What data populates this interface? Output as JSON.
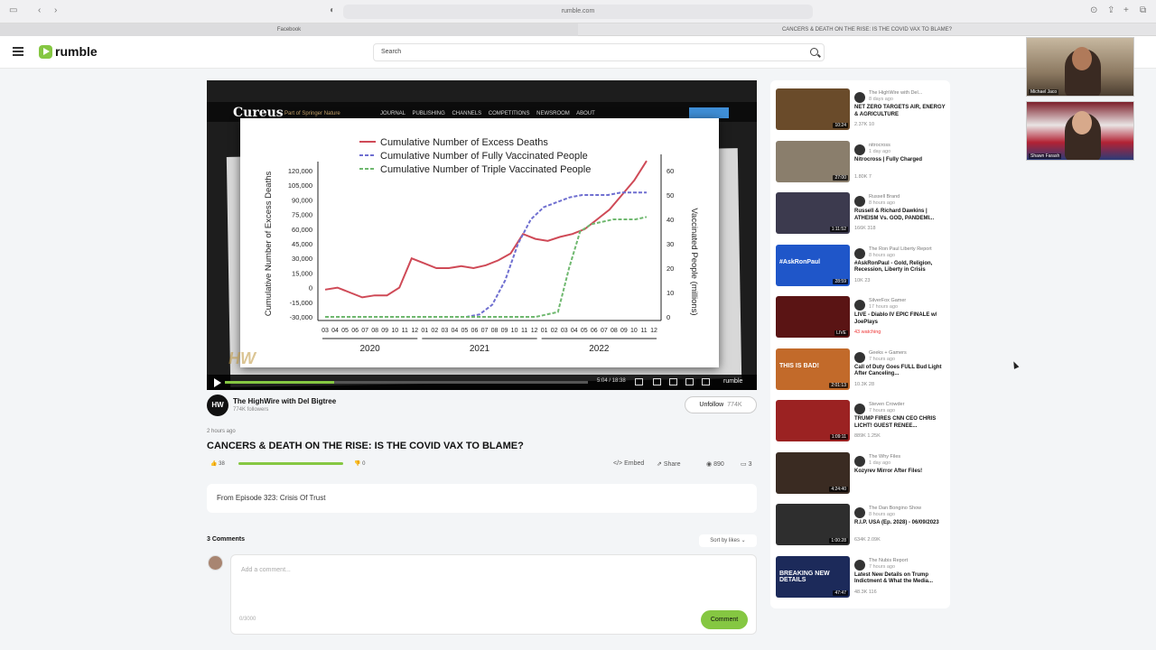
{
  "browser": {
    "url": "rumble.com",
    "tabs": [
      "Facebook",
      "CANCERS & DEATH ON THE RISE: IS THE COVID VAX TO BLAME?"
    ]
  },
  "header": {
    "logo": "rumble",
    "search_placeholder": "Search"
  },
  "webcams": [
    {
      "name": "Michael Jaco"
    },
    {
      "name": "Shawn Farash"
    }
  ],
  "player": {
    "site_logo": "Cureus",
    "site_sub": "Part of Springer Nature",
    "site_nav": "JOURNAL PUBLISHING CHANNELS COMPETITIONS NEWSROOM ABOUT",
    "time": "5:04 / 18:38",
    "brand": "rumble",
    "progress_fraction": 0.3
  },
  "chart_data": {
    "type": "line",
    "title": "",
    "ylabel": "Cumulative Number of Excess Deaths",
    "y2label": "Vaccinated People (millions)",
    "yticks": [
      "120,000",
      "105,000",
      "90,000",
      "75,000",
      "60,000",
      "45,000",
      "30,000",
      "15,000",
      "0",
      "-15,000",
      "-30,000"
    ],
    "ylim": [
      -30000,
      120000
    ],
    "y2ticks": [
      "60",
      "50",
      "40",
      "30",
      "20",
      "10",
      "0"
    ],
    "y2lim": [
      0,
      60
    ],
    "xticks": [
      "03",
      "04",
      "05",
      "06",
      "07",
      "08",
      "09",
      "10",
      "11",
      "12",
      "01",
      "02",
      "03",
      "04",
      "05",
      "06",
      "07",
      "08",
      "09",
      "10",
      "11",
      "12",
      "01",
      "02",
      "03",
      "04",
      "05",
      "06",
      "07",
      "08",
      "09",
      "10",
      "11",
      "12"
    ],
    "years": [
      "2020",
      "2021",
      "2022"
    ],
    "legend_position": "top",
    "series": [
      {
        "name": "Cumulative Number of Excess Deaths",
        "color": "#cf4a57",
        "axis": "left",
        "values": [
          -2000,
          0,
          -5000,
          -10000,
          -8000,
          -8000,
          0,
          30000,
          25000,
          20000,
          20000,
          22000,
          20000,
          23000,
          28000,
          35000,
          55000,
          50000,
          48000,
          52000,
          55000,
          60000,
          70000,
          80000,
          95000,
          110000,
          130000
        ]
      },
      {
        "name": "Cumulative Number of Fully Vaccinated People",
        "color": "#6f6fd0",
        "axis": "right",
        "values": [
          0,
          0,
          0,
          0,
          0,
          0,
          0,
          0,
          0,
          0,
          0,
          0,
          1,
          5,
          15,
          30,
          40,
          45,
          47,
          49,
          50,
          50,
          50,
          51,
          51,
          51
        ]
      },
      {
        "name": "Cumulative Number of Triple Vaccinated People",
        "color": "#6fb86f",
        "axis": "right",
        "values": [
          0,
          0,
          0,
          0,
          0,
          0,
          0,
          0,
          0,
          0,
          0,
          0,
          0,
          0,
          0,
          0,
          0,
          0,
          0,
          0,
          1,
          2,
          20,
          35,
          38,
          39,
          40,
          40,
          40,
          41
        ]
      }
    ]
  },
  "channel": {
    "avatar": "HW",
    "name": "The HighWire with Del Bigtree",
    "followers": "774K followers",
    "unfollow_label": "Unfollow",
    "unfollow_count": "774K"
  },
  "video": {
    "posted": "2 hours ago",
    "title": "CANCERS & DEATH ON THE RISE: IS THE COVID VAX TO BLAME?",
    "likes": "38",
    "dislikes": "0",
    "embed": "Embed",
    "share": "Share",
    "views": "890",
    "comment_count": "3",
    "description": "From Episode 323: Crisis Of Trust"
  },
  "comments": {
    "header": "3 Comments",
    "sort": "Sort by likes",
    "placeholder": "Add a comment...",
    "counter": "0/3000",
    "button": "Comment"
  },
  "sidebar": [
    {
      "channel": "The HighWire with Del...",
      "ago": "8 days ago",
      "title": "NET ZERO TARGETS AIR, ENERGY & AGRICULTURE",
      "stats": "2.37K  10",
      "duration": "10:24",
      "color": "#6a4b2a"
    },
    {
      "channel": "nitrocross",
      "ago": "1 day ago",
      "title": "Nitrocross | Fully Charged",
      "stats": "1.80K  7",
      "duration": "27:00",
      "color": "#8a7e6c"
    },
    {
      "channel": "Russell Brand",
      "ago": "8 hours ago",
      "title": "Russell & Richard Dawkins | ATHEISM Vs. GOD, PANDEMI...",
      "stats": "166K  318",
      "duration": "1:11:52",
      "color": "#3c3a4e"
    },
    {
      "channel": "The Ron Paul Liberty Report",
      "ago": "8 hours ago",
      "title": "#AskRonPaul - Gold, Religion, Recession, Liberty in Crisis",
      "stats": "10K  23",
      "duration": "28:59",
      "color": "#1f56c9",
      "thumb_text": "#AskRonPaul"
    },
    {
      "channel": "SilverFox Gamer",
      "ago": "17 hours ago",
      "title": "LIVE - Diablo IV EPIC FINALE w/ JoePlays",
      "live": "43 watching",
      "duration": "LIVE",
      "color": "#5a1414"
    },
    {
      "channel": "Geeks + Gamers",
      "ago": "7 hours ago",
      "title": "Call of Duty Goes FULL Bud Light After Canceling...",
      "stats": "10.3K  28",
      "duration": "2:01:13",
      "color": "#c26a2a",
      "thumb_text": "THIS IS BAD!"
    },
    {
      "channel": "Steven Crowder",
      "ago": "7 hours ago",
      "title": "TRUMP FIRES CNN CEO CHRIS LICHT! GUEST RENEE...",
      "stats": "889K  1.25K",
      "duration": "1:09:11",
      "color": "#9b2222"
    },
    {
      "channel": "The Why Files",
      "ago": "1 day ago",
      "title": "Kozyrev Mirror After Files!",
      "stats": "",
      "duration": "4:24:40",
      "color": "#3a2b22"
    },
    {
      "channel": "The Dan Bongino Show",
      "ago": "8 hours ago",
      "title": "R.I.P. USA (Ep. 2028) - 06/09/2023",
      "stats": "634K  2.09K",
      "duration": "1:00:28",
      "color": "#2e2e2e"
    },
    {
      "channel": "The Nubis Report",
      "ago": "7 hours ago",
      "title": "Latest New Details on Trump Indictment & What the Media...",
      "stats": "48.3K  116",
      "duration": "47:47",
      "color": "#1c2a5a",
      "thumb_text": "BREAKING NEW DETAILS"
    }
  ]
}
